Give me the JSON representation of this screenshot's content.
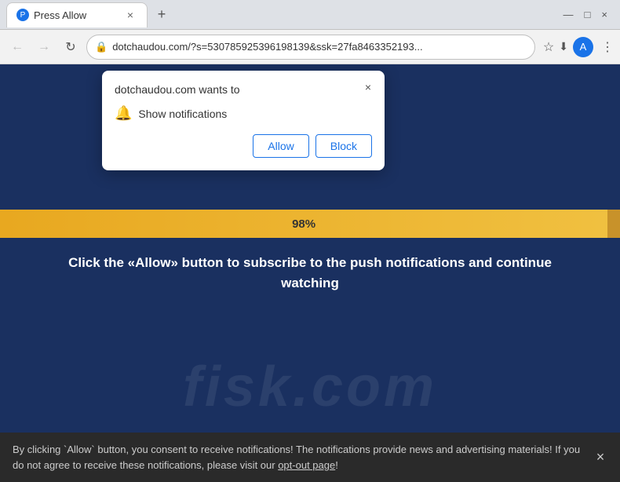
{
  "browser": {
    "tab": {
      "favicon_label": "P",
      "title": "Press Allow",
      "close_label": "×"
    },
    "new_tab_label": "+",
    "window_controls": {
      "minimize": "—",
      "maximize": "□",
      "close": "×"
    },
    "toolbar": {
      "back_label": "←",
      "forward_label": "→",
      "reload_label": "↻",
      "address": "dotchaudou.com/?s=530785925396198139&ssk=27fa8463352193...",
      "star_label": "☆",
      "profile_label": "A",
      "menu_label": "⋮",
      "download_label": "⬇"
    }
  },
  "permission_popup": {
    "title": "dotchaudou.com wants to",
    "close_label": "×",
    "permission_label": "Show notifications",
    "allow_label": "Allow",
    "block_label": "Block"
  },
  "page": {
    "watermark": "fisk.com",
    "progress_percent": "98%",
    "cta_text_before": "Click the «",
    "cta_allow": "Allow",
    "cta_text_after": "» button to subscribe to the push notifications and continue watching"
  },
  "bottom_banner": {
    "text": "By clicking `Allow` button, you consent to receive notifications! The notifications provide news and advertising materials! If you do not agree to receive these notifications, please visit our ",
    "link_text": "opt-out page",
    "text_end": "!",
    "close_label": "×"
  }
}
